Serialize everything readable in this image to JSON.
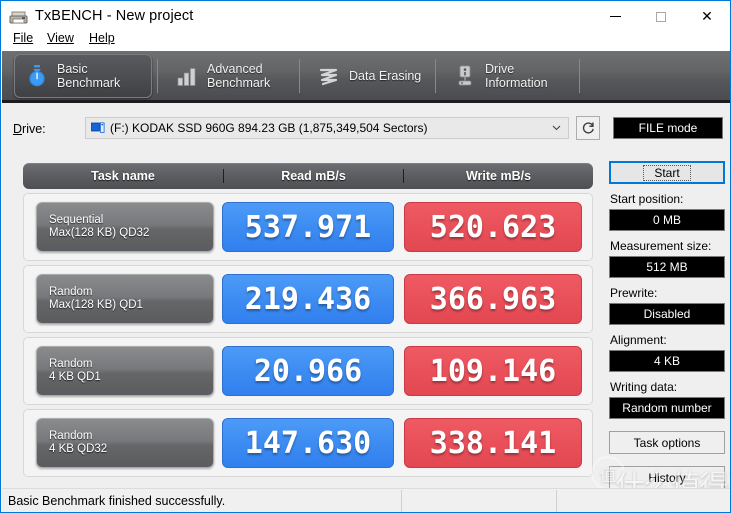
{
  "window": {
    "title": "TxBENCH - New project",
    "icon": "printer-icon",
    "controls": {
      "minimize": "minimize-icon",
      "maximize": "maximize-icon",
      "close": "close-icon"
    }
  },
  "menubar": {
    "items": [
      {
        "label": "File",
        "accel": "F"
      },
      {
        "label": "View",
        "accel": "V"
      },
      {
        "label": "Help",
        "accel": "H"
      }
    ]
  },
  "tabs": [
    {
      "line1": "Basic",
      "line2": "Benchmark",
      "icon": "stopwatch-icon",
      "active": true
    },
    {
      "line1": "Advanced",
      "line2": "Benchmark",
      "icon": "bar-chart-icon",
      "active": false
    },
    {
      "line1": "Data Erasing",
      "line2": "",
      "icon": "scribble-erase-icon",
      "active": false
    },
    {
      "line1": "Drive",
      "line2": "Information",
      "icon": "drive-info-icon",
      "active": false
    }
  ],
  "drive_row": {
    "label": "Drive:",
    "icon": "hard-drive-icon",
    "selected": "(F:) KODAK SSD 960G  894.23 GB (1,875,349,504 Sectors)",
    "dropdown_icon": "chevron-down-icon",
    "refresh_icon": "refresh-icon",
    "mode_button": "FILE mode"
  },
  "results": {
    "headers": {
      "task": "Task name",
      "read": "Read mB/s",
      "write": "Write mB/s"
    },
    "rows": [
      {
        "task_line1": "Sequential",
        "task_line2": "Max(128 KB) QD32",
        "read": "537.971",
        "write": "520.623"
      },
      {
        "task_line1": "Random",
        "task_line2": "Max(128 KB) QD1",
        "read": "219.436",
        "write": "366.963"
      },
      {
        "task_line1": "Random",
        "task_line2": "4 KB QD1",
        "read": "20.966",
        "write": "109.146"
      },
      {
        "task_line1": "Random",
        "task_line2": "4 KB QD32",
        "read": "147.630",
        "write": "338.141"
      }
    ]
  },
  "sidebar": {
    "start_button": "Start",
    "start_accel": "S",
    "fields": [
      {
        "label": "Start position:",
        "value": "0 MB"
      },
      {
        "label": "Measurement size:",
        "value": "512 MB"
      },
      {
        "label": "Prewrite:",
        "value": "Disabled"
      },
      {
        "label": "Alignment:",
        "value": "4 KB"
      },
      {
        "label": "Writing data:",
        "value": "Random number"
      }
    ],
    "task_options": "Task options",
    "task_options_accel": "T",
    "history": "History",
    "history_accel": "s"
  },
  "statusbar": {
    "message": "Basic Benchmark finished successfully.",
    "segment2": "",
    "segment3": ""
  },
  "watermark": {
    "mark": "值",
    "text": "什么值得买"
  },
  "colors": {
    "accent_blue": "#0078d7",
    "read_blue": "#3d8cf2",
    "write_red": "#e9505a",
    "panel_bg": "#efefef",
    "tab_dark": "#5c5d60"
  }
}
